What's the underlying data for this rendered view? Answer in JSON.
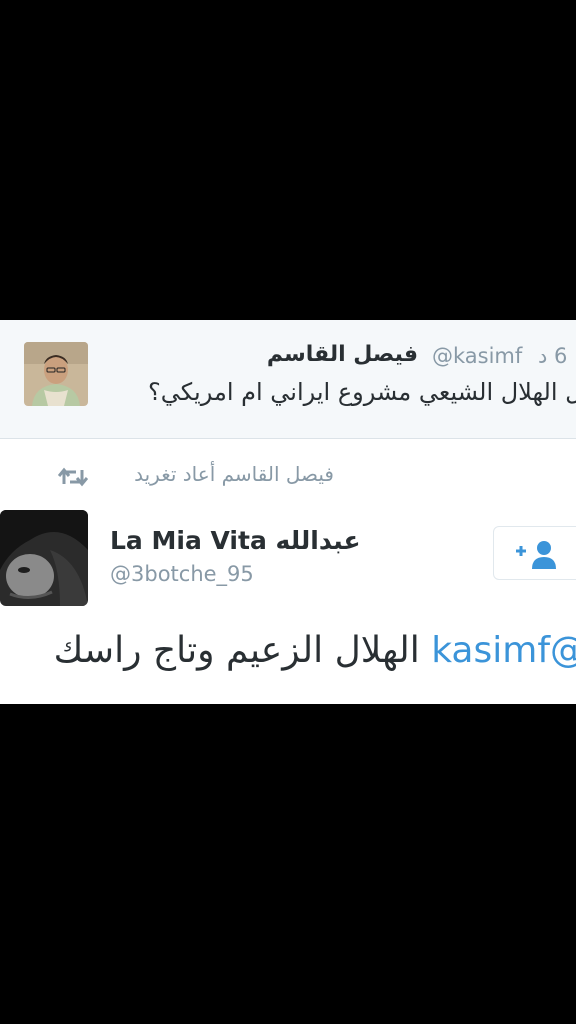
{
  "quoted_tweet": {
    "author_name": "فيصل القاسم",
    "handle": "@kasimf",
    "time": "6 د",
    "text": "هل الهلال الشيعي مشروع ايراني ام امريكي؟"
  },
  "retweet_context": {
    "text": "فيصل القاسم أعاد تغريد",
    "icon": "retweet-icon"
  },
  "tweet": {
    "display_name": "La Mia Vita عبدالله",
    "handle": "@3botche_95",
    "mention": "@kasimf",
    "body": "الهلال الزعيم وتاج راسك"
  },
  "follow_button": {
    "icon": "add-user-icon"
  },
  "colors": {
    "link_blue": "#3b94d9",
    "meta_gray": "#8899a6",
    "text_dark": "#292f33",
    "retweet_green": "#5c913b",
    "quoted_bg": "#f5f8fa"
  }
}
